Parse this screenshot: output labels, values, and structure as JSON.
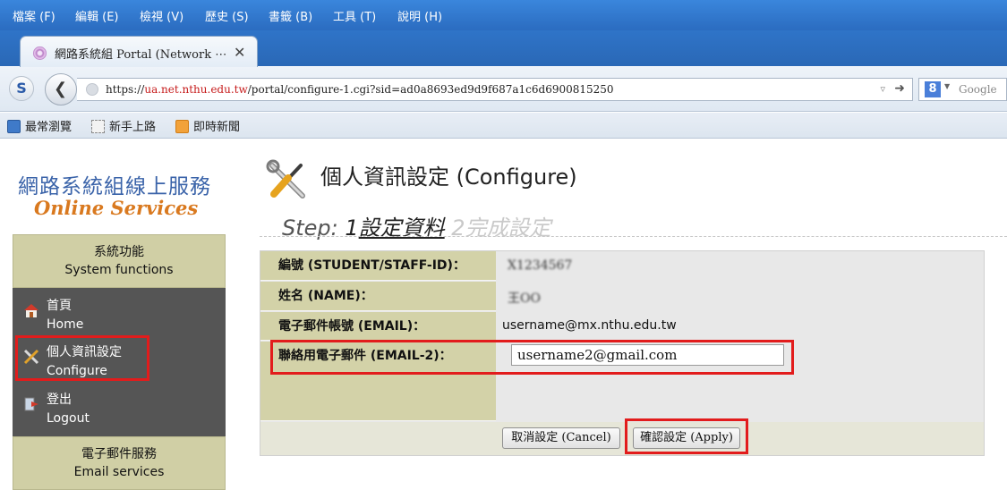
{
  "browser": {
    "menu": [
      "檔案 (F)",
      "編輯 (E)",
      "檢視 (V)",
      "歷史 (S)",
      "書籤 (B)",
      "工具 (T)",
      "說明 (H)"
    ],
    "tab_title": "網路系統組 Portal (Network ⋯",
    "tab_close": "✕",
    "url_prefix": "https://",
    "url_domain": "ua.net.nthu.edu.tw",
    "url_path": "/portal/configure-1.cgi?sid=ad0a8693ed9d9f687a1c6d6900815250",
    "search_placeholder": "Google",
    "bookmarks": [
      "最常瀏覽",
      "新手上路",
      "即時新聞"
    ]
  },
  "brand": {
    "title_zh": "網路系統組線上服務",
    "title_en": "Online Services"
  },
  "sidebar": {
    "section_system": {
      "zh": "系統功能",
      "en": "System functions"
    },
    "items": [
      {
        "zh": "首頁",
        "en": "Home"
      },
      {
        "zh": "個人資訊設定",
        "en": "Configure"
      },
      {
        "zh": "登出",
        "en": "Logout"
      }
    ],
    "section_email": {
      "zh": "電子郵件服務",
      "en": "Email services"
    }
  },
  "main": {
    "title": "個人資訊設定 (Configure)",
    "step_label": "Step:",
    "step1_num": "1",
    "step1_text": "設定資料",
    "step2_num": "2",
    "step2_text": "完成設定",
    "fields": {
      "id_label": "編號 (STUDENT/STAFF-ID)：",
      "id_value": "X1234567",
      "name_label": "姓名 (NAME)：",
      "name_value": "王OO",
      "email_label": "電子郵件帳號 (EMAIL)：",
      "email_value": "username@mx.nthu.edu.tw",
      "email2_label": "聯絡用電子郵件 (EMAIL-2)：",
      "email2_value": "username2@gmail.com"
    },
    "buttons": {
      "cancel": "取消設定 (Cancel)",
      "apply": "確認設定 (Apply)"
    }
  },
  "colors": {
    "highlight": "#e21c1c",
    "label_bg": "#d3d2a8",
    "brand_blue": "#3a63a9",
    "brand_orange": "#d9791f",
    "sidebar_bg": "#555555"
  }
}
